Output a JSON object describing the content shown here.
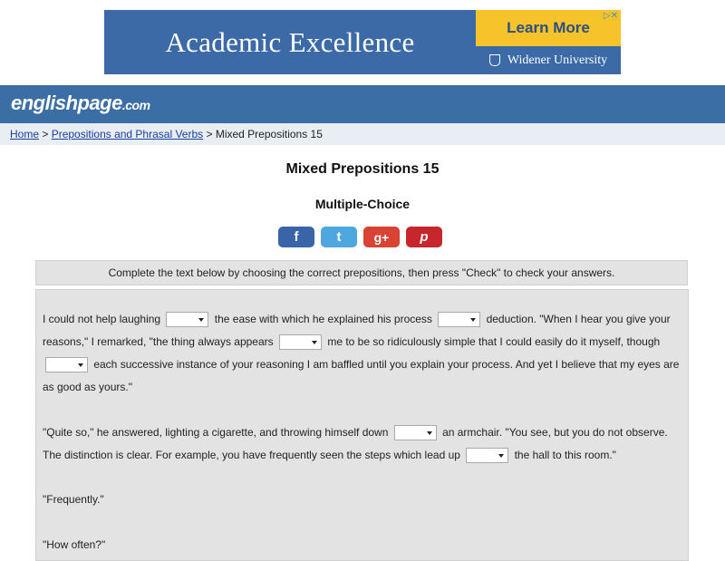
{
  "ad": {
    "headline": "Academic Excellence",
    "cta": "Learn More",
    "brand": "Widener University",
    "choices_icon": "adchoices-icon"
  },
  "header": {
    "logo_main": "englishpage",
    "logo_suffix": ".com"
  },
  "breadcrumb": {
    "home": "Home",
    "sep1": " > ",
    "section": "Prepositions and Phrasal Verbs",
    "sep2": " > ",
    "current": "Mixed Prepositions 15"
  },
  "page": {
    "title": "Mixed Prepositions 15",
    "subtitle": "Multiple-Choice"
  },
  "social": {
    "facebook": "f",
    "twitter": "t",
    "googleplus": "g+",
    "pinterest": "p"
  },
  "instructions": "Complete the text below by choosing the correct prepositions, then press \"Check\" to check your answers.",
  "exercise": {
    "p1": [
      "I could not help laughing ",
      " the ease with which he explained his process ",
      " deduction. \"When I hear you give your reasons,\" I remarked, \"the thing always appears ",
      " me to be so ridiculously simple that I could easily do it myself, though ",
      " each successive instance of your reasoning I am baffled until you explain your process. And yet I believe that my eyes are as good as yours.\""
    ],
    "p2": [
      "\"Quite so,\" he answered, lighting a cigarette, and throwing himself down ",
      " an armchair. \"You see, but you do not observe. The distinction is clear. For example, you have frequently seen the steps which lead up ",
      " the hall to this room.\""
    ],
    "p3": "\"Frequently.\"",
    "p4": "\"How often?\""
  }
}
